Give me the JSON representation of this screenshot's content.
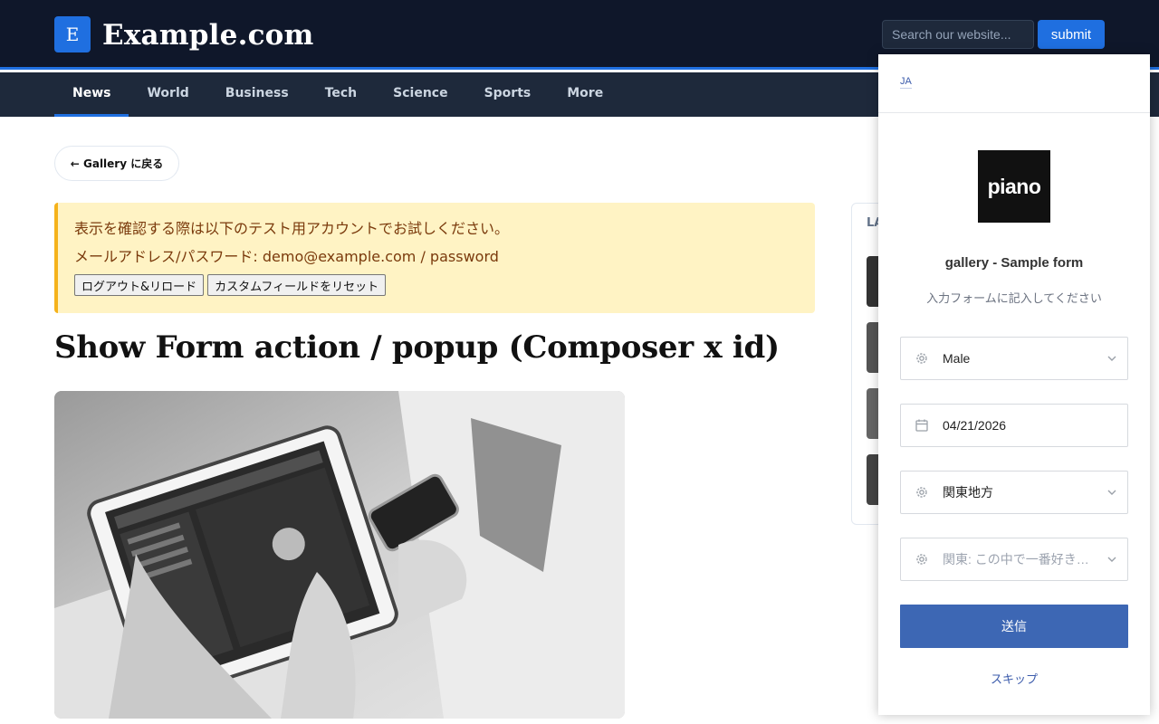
{
  "header": {
    "logo_letter": "E",
    "site_name": "Example.com",
    "search_placeholder": "Search our website...",
    "submit_label": "submit"
  },
  "nav": {
    "items": [
      {
        "label": "News",
        "active": true
      },
      {
        "label": "World"
      },
      {
        "label": "Business"
      },
      {
        "label": "Tech"
      },
      {
        "label": "Science"
      },
      {
        "label": "Sports"
      },
      {
        "label": "More"
      }
    ]
  },
  "main": {
    "back_label": "← Gallery に戻る",
    "notice": {
      "line1": "表示を確認する際は以下のテスト用アカウントでお試しください。",
      "line2": "メールアドレス/パスワード: demo@example.com / password",
      "logout_label": "ログアウト&リロード",
      "reset_label": "カスタムフィールドをリセット"
    },
    "title": "Show Form action / popup (Composer x id)"
  },
  "sidebar": {
    "label": "LA"
  },
  "modal": {
    "lang": "JA",
    "logo_text": "piano",
    "title": "gallery - Sample form",
    "subtitle": "入力フォームに記入してください",
    "fields": [
      {
        "value": "Male",
        "icon": "gear-icon"
      },
      {
        "value": "04/21/2026",
        "icon": "calendar-icon"
      },
      {
        "value": "関東地方",
        "icon": "gear-icon"
      },
      {
        "placeholder": "関東: この中で一番好きな都県は？",
        "icon": "gear-icon"
      }
    ],
    "submit_label": "送信",
    "skip_label": "スキップ"
  },
  "colors": {
    "header_bg": "#0f172a",
    "nav_bg": "#1e293b",
    "accent": "#1f6fe0",
    "notice_bg": "#fff3c4",
    "notice_border": "#f5b21b",
    "modal_button": "#3d67b4"
  }
}
